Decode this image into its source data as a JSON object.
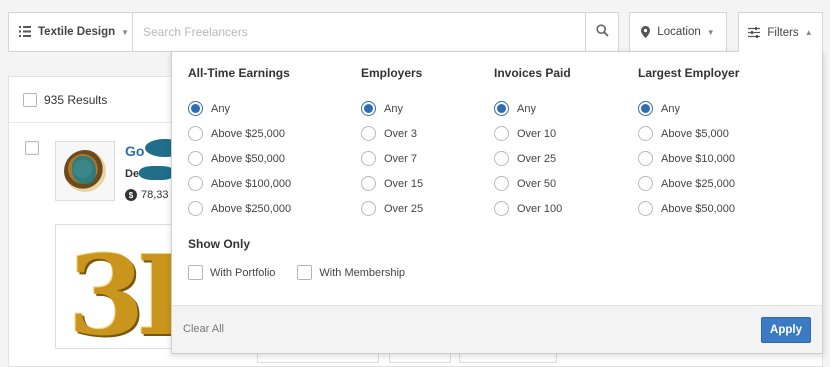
{
  "toolbar": {
    "category_label": "Textile Design",
    "search_placeholder": "Search Freelancers",
    "location_label": "Location",
    "filters_label": "Filters"
  },
  "results": {
    "count_label": "935 Results",
    "freelancer": {
      "name": "Go",
      "title": "De",
      "earnings": "78,33"
    }
  },
  "filters": {
    "columns": [
      {
        "heading": "All-Time Earnings",
        "options": [
          "Any",
          "Above $25,000",
          "Above $50,000",
          "Above $100,000",
          "Above $250,000"
        ],
        "selected": 0
      },
      {
        "heading": "Employers",
        "options": [
          "Any",
          "Over 3",
          "Over 7",
          "Over 15",
          "Over 25"
        ],
        "selected": 0
      },
      {
        "heading": "Invoices Paid",
        "options": [
          "Any",
          "Over 10",
          "Over 25",
          "Over 50",
          "Over 100"
        ],
        "selected": 0
      },
      {
        "heading": "Largest Employer",
        "options": [
          "Any",
          "Above $5,000",
          "Above $10,000",
          "Above $25,000",
          "Above $50,000"
        ],
        "selected": 0
      }
    ],
    "show_only": {
      "heading": "Show Only",
      "options": [
        "With Portfolio",
        "With Membership"
      ]
    },
    "clear_label": "Clear All",
    "apply_label": "Apply"
  },
  "colors": {
    "accent": "#2e6cb6",
    "apply_button": "#3b7bc4"
  },
  "icons": [
    "list-icon",
    "search-icon",
    "location-pin-icon",
    "sliders-icon",
    "chevron-down-icon",
    "chevron-up-icon",
    "dollar-icon"
  ]
}
